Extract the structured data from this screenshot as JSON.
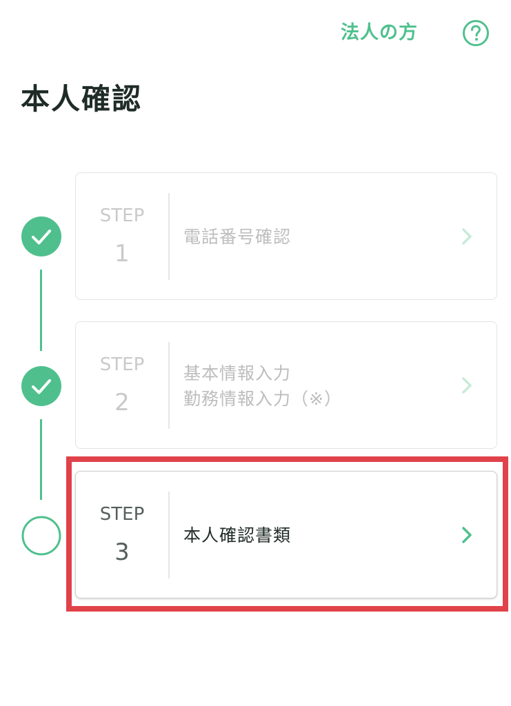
{
  "header": {
    "corporate_link": "法人の方",
    "help_icon": "question-circle-icon"
  },
  "page_title": "本人確認",
  "colors": {
    "accent": "#4fc08d",
    "highlight": "#e0424a",
    "title": "#1f2b27"
  },
  "steps": [
    {
      "label": "STEP",
      "number": "1",
      "lines": [
        "電話番号確認"
      ],
      "status": "completed",
      "icon": "check-circle-icon"
    },
    {
      "label": "STEP",
      "number": "2",
      "lines": [
        "基本情報入力",
        "勤務情報入力（※）"
      ],
      "status": "completed",
      "icon": "check-circle-icon"
    },
    {
      "label": "STEP",
      "number": "3",
      "lines": [
        "本人確認書類"
      ],
      "status": "current",
      "icon": "empty-circle-icon"
    }
  ]
}
